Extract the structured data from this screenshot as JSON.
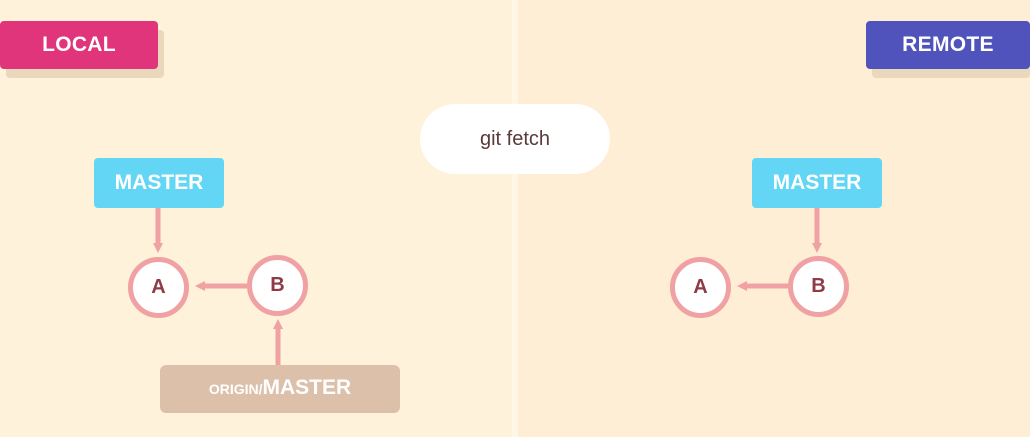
{
  "panels": {
    "local": {
      "label": "LOCAL",
      "color": "#e0357a"
    },
    "remote": {
      "label": "REMOTE",
      "color": "#5053bb"
    }
  },
  "command": {
    "text": "git fetch"
  },
  "local": {
    "master_label": "MASTER",
    "origin_prefix": "ORIGIN/",
    "origin_main": "MASTER",
    "nodes": {
      "a": "A",
      "b": "B"
    }
  },
  "remote": {
    "master_label": "MASTER",
    "nodes": {
      "a": "A",
      "b": "B"
    }
  },
  "colors": {
    "ref": "#63d6f5",
    "origin_ref": "#dcc0aa",
    "node_border": "#f0a1a3",
    "node_text": "#8f3b47",
    "arrow": "#f0a1a3"
  }
}
